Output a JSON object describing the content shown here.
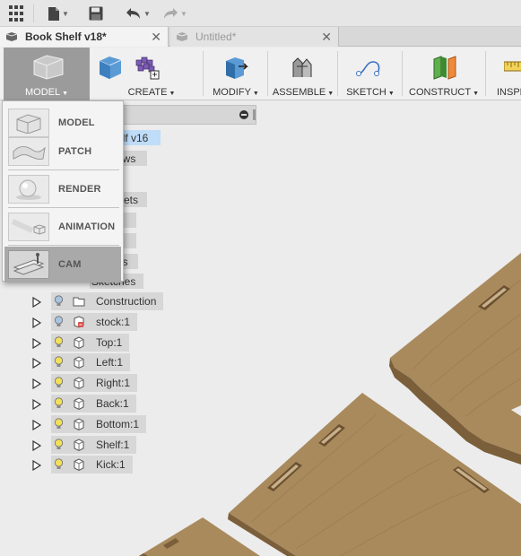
{
  "tabs": [
    {
      "title": "Book Shelf v18*",
      "active": true
    },
    {
      "title": "Untitled*",
      "active": false
    }
  ],
  "toolbar": {
    "workspace_label": "MODEL",
    "groups": [
      {
        "label": "CREATE"
      },
      {
        "label": "MODIFY"
      },
      {
        "label": "ASSEMBLE"
      },
      {
        "label": "SKETCH"
      },
      {
        "label": "CONSTRUCT"
      },
      {
        "label": "INSPE"
      }
    ]
  },
  "workspace_menu": {
    "items": [
      {
        "label": "MODEL",
        "selected": false
      },
      {
        "label": "PATCH",
        "selected": false
      },
      {
        "label": "RENDER",
        "selected": false
      },
      {
        "label": "ANIMATION",
        "selected": false
      },
      {
        "label": "CAM",
        "selected": true
      }
    ]
  },
  "browser": {
    "root_partial": "elf v16",
    "hidden_partials": [
      "ews",
      "Sets",
      "n",
      "e",
      "es",
      "Sketches"
    ],
    "rows": [
      {
        "label": "Construction",
        "type": "folder",
        "light": "off"
      },
      {
        "label": "stock:1",
        "type": "component-red",
        "light": "off"
      },
      {
        "label": "Top:1",
        "type": "body",
        "light": "on"
      },
      {
        "label": "Left:1",
        "type": "body",
        "light": "on"
      },
      {
        "label": "Right:1",
        "type": "body",
        "light": "on"
      },
      {
        "label": "Back:1",
        "type": "body",
        "light": "on"
      },
      {
        "label": "Bottom:1",
        "type": "body",
        "light": "on"
      },
      {
        "label": "Shelf:1",
        "type": "body",
        "light": "on"
      },
      {
        "label": "Kick:1",
        "type": "body",
        "light": "on"
      }
    ]
  },
  "colors": {
    "wood": "#a98a5d",
    "wood_edge": "#7a5f3a",
    "selection": "#bfdcf8",
    "bulb_on": "#f2e05a",
    "bulb_off": "#a8c4e0"
  }
}
